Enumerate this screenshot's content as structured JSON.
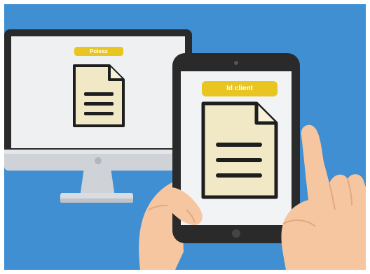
{
  "colors": {
    "background": "#3f8fd2",
    "accent_yellow": "#e8c521",
    "document_paper": "#f1e8c5",
    "device_dark": "#2a2a2a",
    "skin": "#f6c6a0"
  },
  "monitor": {
    "label": "Poleax",
    "document_icon": "document-icon"
  },
  "tablet": {
    "label": "Id client",
    "document_icon": "document-icon"
  },
  "hands": [
    "left-hand",
    "right-hand-pointing"
  ]
}
